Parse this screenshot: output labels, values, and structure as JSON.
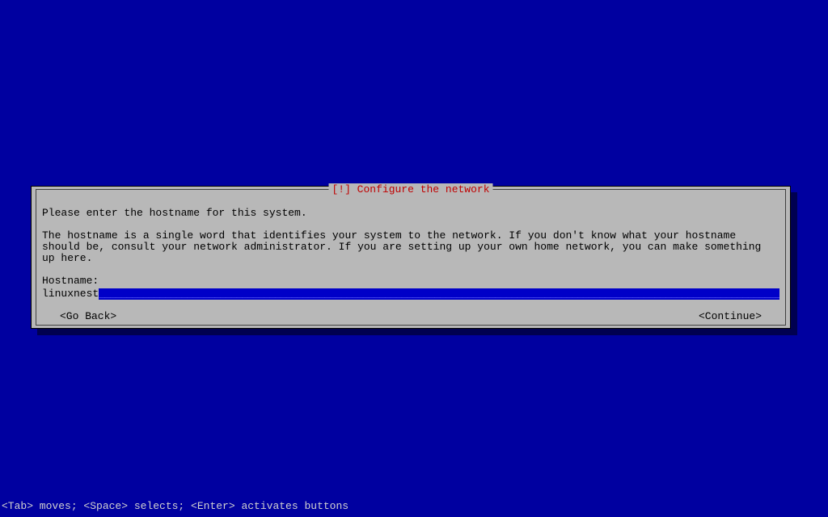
{
  "dialog": {
    "title": "[!] Configure the network",
    "prompt": "Please enter the hostname for this system.",
    "help_text": "The hostname is a single word that identifies your system to the network. If you don't know what your hostname should be, consult your network administrator. If you are setting up your own home network, you can make something up here.",
    "field_label": "Hostname:",
    "input_value": "linuxnest",
    "go_back_label": "<Go Back>",
    "continue_label": "<Continue>"
  },
  "footer": {
    "help_text": "<Tab> moves; <Space> selects; <Enter> activates buttons"
  }
}
